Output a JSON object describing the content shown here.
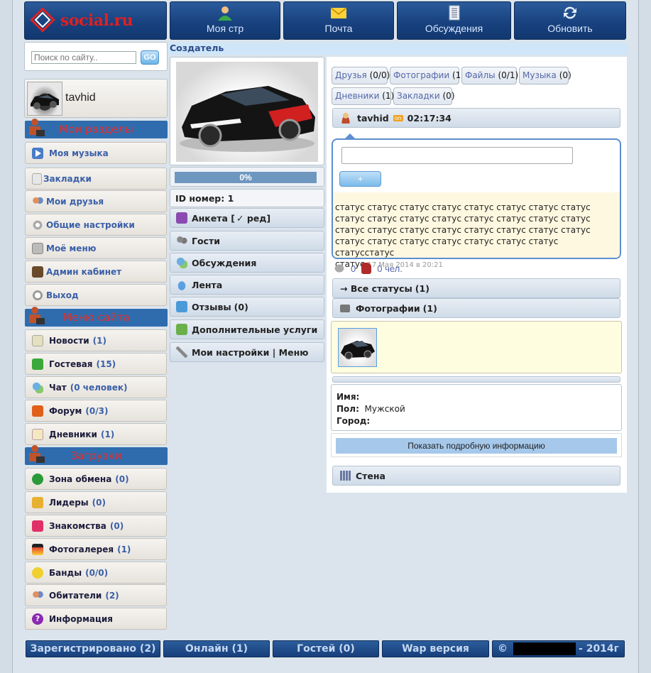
{
  "logo": {
    "text": "social.ru"
  },
  "nav": [
    {
      "label": "Моя стр",
      "icon": "user-icon"
    },
    {
      "label": "Почта",
      "icon": "mail-icon"
    },
    {
      "label": "Обсуждения",
      "icon": "document-icon"
    },
    {
      "label": "Обновить",
      "icon": "refresh-icon"
    }
  ],
  "search": {
    "placeholder": "Поиск по сайту..",
    "button": "GO"
  },
  "user": {
    "name": "tavhid"
  },
  "sections": {
    "my": "Мои разделы",
    "site": "Меню сайта",
    "downloads": "Загрузки"
  },
  "my_menu": [
    {
      "label": "Моя музыка"
    },
    {
      "label": "Закладки"
    },
    {
      "label": "Мои друзья"
    },
    {
      "label": "Общие настройки"
    },
    {
      "label": "Моё меню"
    },
    {
      "label": "Админ кабинет"
    },
    {
      "label": "Выход"
    }
  ],
  "site_menu": [
    {
      "label": "Новости",
      "count": "(1)"
    },
    {
      "label": "Гостевая",
      "count": "(15)"
    },
    {
      "label": "Чат",
      "count": "(0 человек)"
    },
    {
      "label": "Форум",
      "count": "(0/3)"
    },
    {
      "label": "Дневники",
      "count": "(1)"
    }
  ],
  "downloads_menu": [
    {
      "label": "Зона обмена",
      "count": "(0)"
    },
    {
      "label": "Лидеры",
      "count": "(0)"
    },
    {
      "label": "Знакомства",
      "count": "(0)"
    },
    {
      "label": "Фотогалерея",
      "count": "(1)"
    },
    {
      "label": "Банды",
      "count": "(0/0)"
    },
    {
      "label": "Обитатели",
      "count": "(2)"
    },
    {
      "label": "Информация",
      "count": ""
    }
  ],
  "profile": {
    "role": "Создатель",
    "progress": "0%",
    "progress_value": 0,
    "id_label": "ID номер: 1",
    "anketa": "Анкета [",
    "anketa_edit": "✓ ред]"
  },
  "mid_menu": [
    {
      "label": "Гости",
      "count": ""
    },
    {
      "label": "Обсуждения",
      "count": ""
    },
    {
      "label": "Лента",
      "count": ""
    },
    {
      "label": "Отзывы",
      "count": "(0)"
    },
    {
      "label": "Дополнительные услуги",
      "count": ""
    },
    {
      "label": "Мои настройки | Меню",
      "count": ""
    }
  ],
  "tags": [
    {
      "label": "Друзья",
      "count": "(0/0)"
    },
    {
      "label": "Фотографии",
      "count": "(1)"
    },
    {
      "label": "Файлы",
      "count": "(0/1)"
    },
    {
      "label": "Музыка",
      "count": "(0)"
    },
    {
      "label": "Дневники",
      "count": "(1)"
    },
    {
      "label": "Закладки",
      "count": "(0)"
    }
  ],
  "status_head": {
    "name": "tavhid",
    "badge": "on",
    "time": "02:17:34"
  },
  "status_box": {
    "button": "+",
    "lines": [
      "статус статус статус статус статус статус статус статус",
      "статус статус статус статус статус статус статус статус",
      "статус статус статус статус статус статус статус статус",
      "статус статус статус статус статус статус статус статусстатус"
    ],
    "last_word": "статус",
    "date": "17 Мая 2014 в 20:21"
  },
  "likes": {
    "comments": "0",
    "people": "0 чел."
  },
  "all_statuses": {
    "label": "→ Все статусы",
    "count": "(1)"
  },
  "photos": {
    "label": "Фотографии",
    "count": "(1)"
  },
  "info": {
    "name_label": "Имя:",
    "gender_label": "Пол:",
    "gender_value": "Мужской",
    "city_label": "Город:",
    "more_button": "Показать подробную информацию"
  },
  "wall": {
    "label": "Стена"
  },
  "footer": [
    {
      "label": "Зарегистрировано (2)"
    },
    {
      "label": "Онлайн (1)"
    },
    {
      "label": "Гостей (0)"
    },
    {
      "label": "Wap версия"
    }
  ],
  "copyright": {
    "prefix": "©",
    "suffix": "- 2014г"
  }
}
